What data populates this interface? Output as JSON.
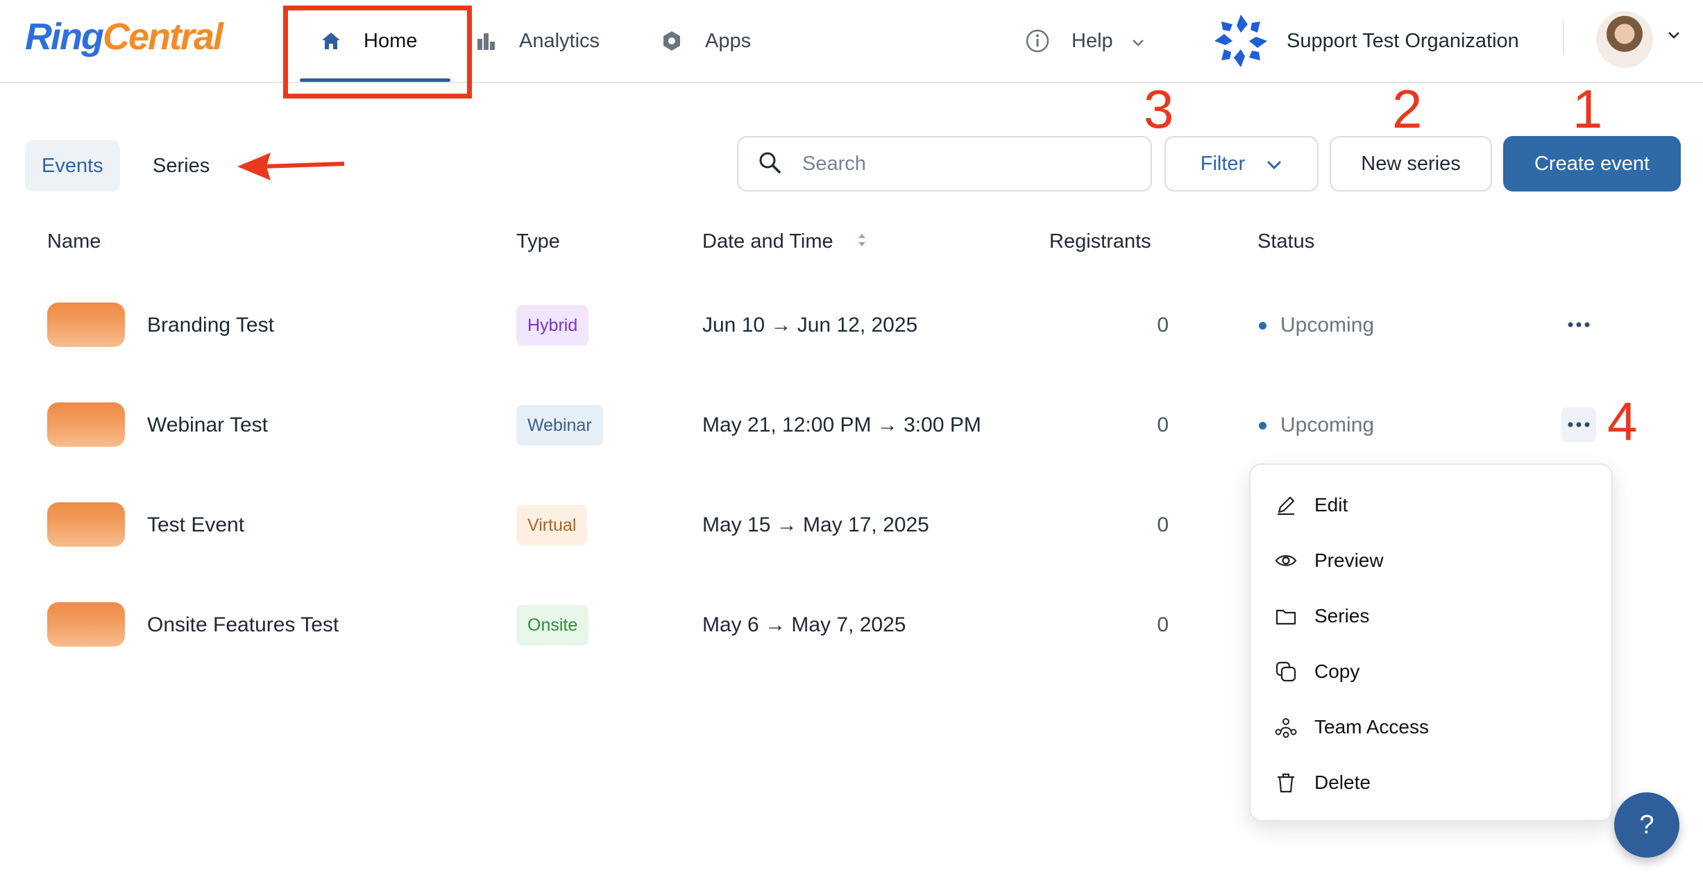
{
  "brand": {
    "logo_part1": "Ring",
    "logo_part2": "Central"
  },
  "nav": {
    "home": "Home",
    "analytics": "Analytics",
    "apps": "Apps",
    "help": "Help",
    "organization": "Support Test Organization"
  },
  "toolbar": {
    "tab_events": "Events",
    "tab_series": "Series",
    "search_placeholder": "Search",
    "filter_label": "Filter",
    "new_series_label": "New series",
    "create_event_label": "Create event"
  },
  "annotations": {
    "n1": "1",
    "n2": "2",
    "n3": "3",
    "n4": "4"
  },
  "table": {
    "headers": {
      "name": "Name",
      "type": "Type",
      "date": "Date and Time",
      "registrants": "Registrants",
      "status": "Status"
    },
    "rows": [
      {
        "name": "Branding Test",
        "type": "Hybrid",
        "date": "Jun 10 → Jun 12, 2025",
        "registrants": "0",
        "status": "Upcoming"
      },
      {
        "name": "Webinar Test",
        "type": "Webinar",
        "date": "May 21, 12:00 PM → 3:00 PM",
        "registrants": "0",
        "status": "Upcoming"
      },
      {
        "name": "Test Event",
        "type": "Virtual",
        "date": "May 15 → May 17, 2025",
        "registrants": "0"
      },
      {
        "name": "Onsite Features Test",
        "type": "Onsite",
        "date": "May 6 → May 7, 2025",
        "registrants": "0"
      }
    ]
  },
  "menu": {
    "items": [
      {
        "label": "Edit",
        "icon": "pencil-icon"
      },
      {
        "label": "Preview",
        "icon": "eye-icon"
      },
      {
        "label": "Series",
        "icon": "folder-icon"
      },
      {
        "label": "Copy",
        "icon": "copy-icon"
      },
      {
        "label": "Team Access",
        "icon": "team-icon"
      },
      {
        "label": "Delete",
        "icon": "trash-icon"
      }
    ]
  },
  "help_fab": "?",
  "colors": {
    "primary": "#2e6aa8",
    "annotation": "#e8391f",
    "brand_blue": "#2f6fdc",
    "brand_orange": "#f28c28"
  }
}
